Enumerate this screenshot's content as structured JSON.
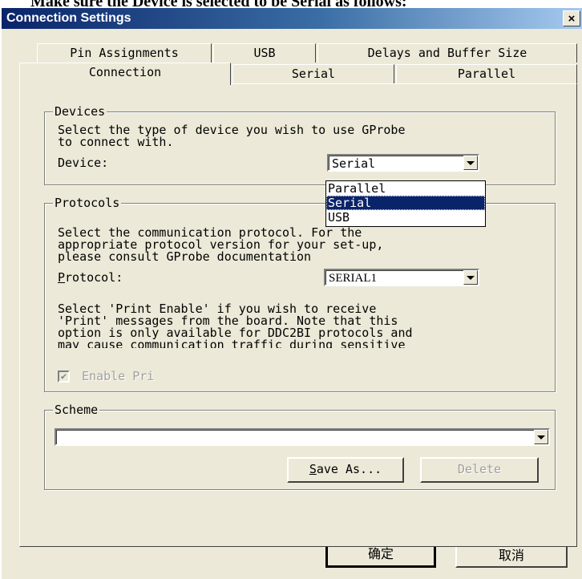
{
  "caption": "Make sure the Device is selected to be Serial as follows:",
  "window": {
    "title": "Connection Settings",
    "close_label": "×"
  },
  "tabs": {
    "row1": [
      "Pin Assignments",
      "USB",
      "Delays and Buffer Size"
    ],
    "row2": [
      "Connection",
      "Serial",
      "Parallel"
    ],
    "active": "Connection"
  },
  "devices": {
    "label": "Devices",
    "description_line1": "Select the type of device you wish to use GProbe",
    "description_line2": "to connect with.",
    "device_label": "Device:",
    "device_value": "Serial",
    "options": [
      "Parallel",
      "Serial",
      "USB"
    ],
    "selected_option": "Serial"
  },
  "protocols": {
    "label": "Protocols",
    "description_line1": "Select the communication protocol.  For the",
    "description_line2": "appropriate protocol version for your set-up,",
    "description_line3": "please consult GProbe documentation",
    "protocol_label_prefix": "P",
    "protocol_label_rest": "rotocol:",
    "protocol_value": "SERIAL1",
    "print_line1": "Select 'Print Enable' if you wish to receive",
    "print_line2": "'Print' messages from the board.   Note that this",
    "print_line3": "option is only available for DDC2BI protocols and",
    "print_line4": "may cause communication traffic during sensitive",
    "enable_print_label": "Enable Pri",
    "enable_print_checked": true
  },
  "scheme": {
    "label": "Scheme",
    "value": "",
    "save_as_prefix": "S",
    "save_as_rest": "ave As...",
    "delete_label": "Delete"
  },
  "footer": {
    "ok_label": "确定",
    "cancel_label": "取消"
  }
}
